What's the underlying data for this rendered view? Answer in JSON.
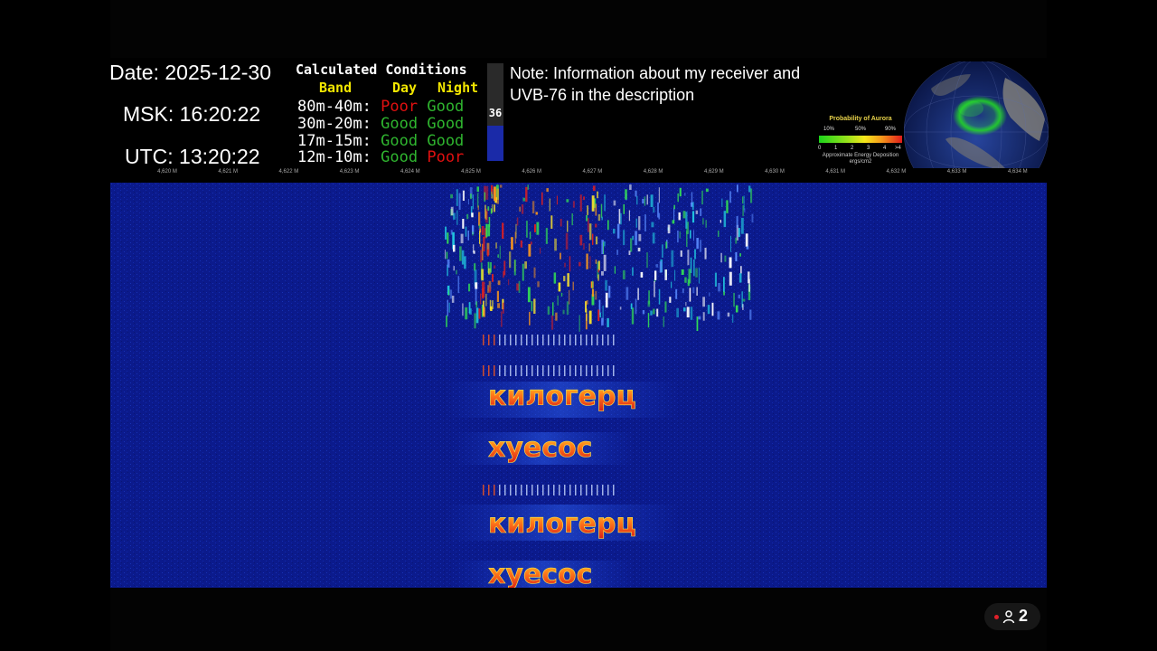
{
  "clock": {
    "date": "Date: 2025-12-30",
    "msk": "MSK: 16:20:22",
    "utc": "UTC: 13:20:22"
  },
  "conditions": {
    "title": "Calculated Conditions",
    "headers": {
      "band": "Band",
      "day": "Day",
      "night": "Night"
    },
    "rows": [
      {
        "band": "80m-40m:",
        "day": "Poor",
        "night": "Good"
      },
      {
        "band": "30m-20m:",
        "day": "Good",
        "night": "Good"
      },
      {
        "band": "17m-15m:",
        "day": "Good",
        "night": "Good"
      },
      {
        "band": "12m-10m:",
        "day": "Good",
        "night": "Poor"
      }
    ],
    "solar_index": "36",
    "solar_index_level": 0.36
  },
  "note": {
    "text": "Note: Information about my receiver and UVB-76 in the description"
  },
  "aurora": {
    "title": "Probability of Aurora",
    "percent_labels": [
      "10%",
      "50%",
      "90%"
    ],
    "ticks": [
      "0",
      "1",
      "2",
      "3",
      "4",
      ">4"
    ],
    "caption": "Approximate Energy Deposition",
    "units": "ergs/cm2",
    "gradient_colors": [
      "#1bd41b",
      "#f5e61b",
      "#e01b1b"
    ]
  },
  "frequency_axis": [
    "4,620 M",
    "4,621 M",
    "4,622 M",
    "4,623 M",
    "4,624 M",
    "4,625 M",
    "4,626 M",
    "4,627 M",
    "4,628 M",
    "4,629 M",
    "4,630 M",
    "4,631 M",
    "4,632 M",
    "4,633 M",
    "4,634 M"
  ],
  "waterfall": {
    "words": [
      "килогерц",
      "хуесос",
      "килогерц",
      "хуесос"
    ],
    "background_color": "#0b1a8c"
  },
  "overlay": {
    "viewer_count": "2",
    "icon": "person-icon",
    "live_color": "#e0202a"
  }
}
